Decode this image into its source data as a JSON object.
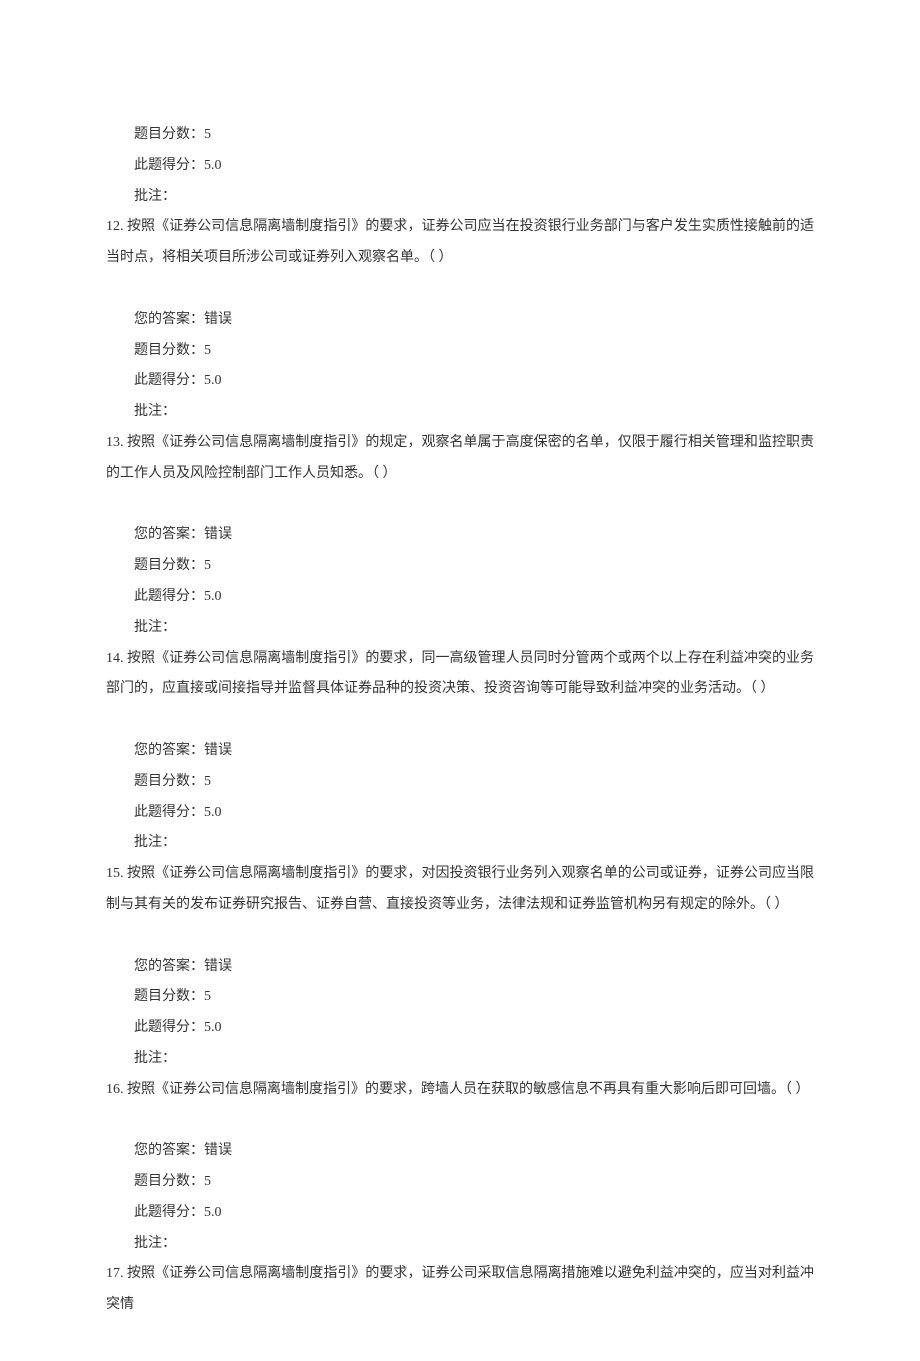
{
  "labels": {
    "your_answer": "您的答案：",
    "question_score": "题目分数：",
    "earned_score": "此题得分：",
    "note": "批注："
  },
  "questions": [
    {
      "number": "12.",
      "text": "按照《证券公司信息隔离墙制度指引》的要求，证券公司应当在投资银行业务部门与客户发生实质性接触前的适当时点，将相关项目所涉公司或证券列入观察名单。（ ）",
      "your_answer": "错误",
      "question_score": "5",
      "earned_score": "5.0",
      "note": "",
      "show_trailing_meta": true
    },
    {
      "number": "13.",
      "text": "按照《证券公司信息隔离墙制度指引》的规定，观察名单属于高度保密的名单，仅限于履行相关管理和监控职责的工作人员及风险控制部门工作人员知悉。（ ）",
      "your_answer": "错误",
      "question_score": "5",
      "earned_score": "5.0",
      "note": ""
    },
    {
      "number": "14.",
      "text": "按照《证券公司信息隔离墙制度指引》的要求，同一高级管理人员同时分管两个或两个以上存在利益冲突的业务部门的，应直接或间接指导并监督具体证券品种的投资决策、投资咨询等可能导致利益冲突的业务活动。（ ）",
      "your_answer": "错误",
      "question_score": "5",
      "earned_score": "5.0",
      "note": ""
    },
    {
      "number": "15.",
      "text": "按照《证券公司信息隔离墙制度指引》的要求，对因投资银行业务列入观察名单的公司或证券，证券公司应当限制与其有关的发布证券研究报告、证券自营、直接投资等业务，法律法规和证券监管机构另有规定的除外。（ ）",
      "your_answer": "错误",
      "question_score": "5",
      "earned_score": "5.0",
      "note": ""
    },
    {
      "number": "16.",
      "text": "按照《证券公司信息隔离墙制度指引》的要求，跨墙人员在获取的敏感信息不再具有重大影响后即可回墙。（ ）",
      "your_answer": "错误",
      "question_score": "5",
      "earned_score": "5.0",
      "note": ""
    },
    {
      "number": "17.",
      "text": "按照《证券公司信息隔离墙制度指引》的要求，证券公司采取信息隔离措施难以避免利益冲突的，应当对利益冲突情",
      "partial": true
    }
  ]
}
